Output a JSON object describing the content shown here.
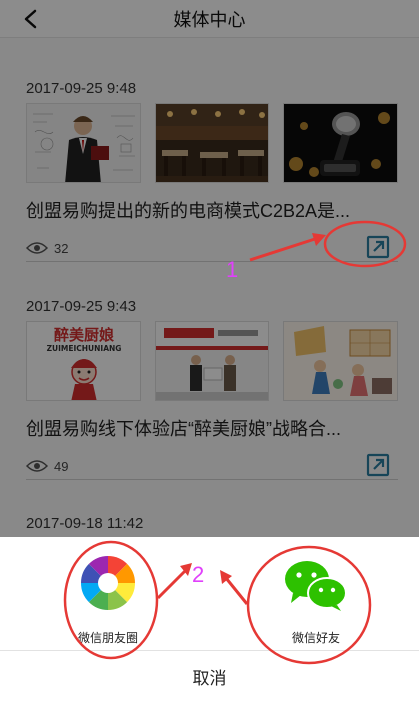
{
  "header": {
    "title": "媒体中心"
  },
  "articles": [
    {
      "date": "2017-09-25 9:48",
      "title": "创盟易购提出的新的电商模式C2B2A是...",
      "views": "32"
    },
    {
      "date": "2017-09-25 9:43",
      "title": "创盟易购线下体验店“醉美厨娘”战略合...",
      "views": "49"
    },
    {
      "date": "2017-09-18 11:42"
    }
  ],
  "thumb_text": {
    "zuimei": "醉美厨娘",
    "zuimei_pinyin": "ZUIMEICHUNIANG"
  },
  "annotations": {
    "label_1": "1",
    "label_2": "2"
  },
  "share_sheet": {
    "moments_label": "微信朋友圈",
    "friend_label": "微信好友",
    "cancel_label": "取消"
  },
  "colors": {
    "accent_icon": "#2a7fa0",
    "annotation_red": "#e53935",
    "annotation_magenta": "#e040fb",
    "wechat_green": "#2dc100"
  }
}
